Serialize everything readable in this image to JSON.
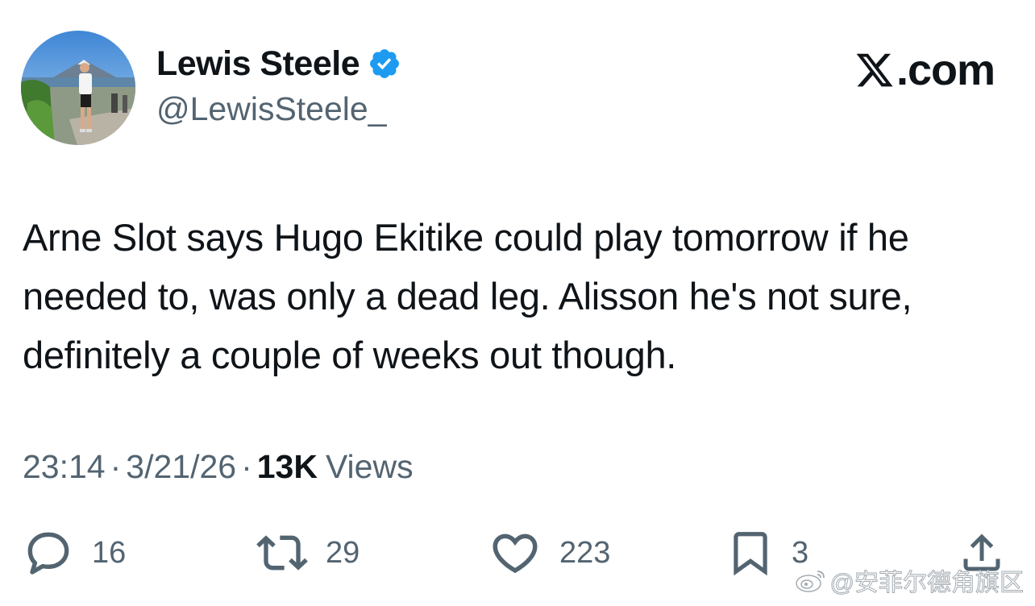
{
  "author": {
    "display_name": "Lewis Steele",
    "handle": "@LewisSteele_",
    "verified": true,
    "verified_color": "#1d9bf0"
  },
  "brand": {
    "suffix": ".com"
  },
  "tweet": {
    "text": "Arne Slot says Hugo Ekitike could play tomorrow if he needed to, was only a dead leg. Alisson he's not sure, definitely a couple of weeks out though."
  },
  "meta": {
    "time": "23:14",
    "date": "3/21/26",
    "separator": "·",
    "views_count": "13K",
    "views_label": "Views"
  },
  "actions": {
    "replies": {
      "icon": "reply-icon",
      "count": "16"
    },
    "reposts": {
      "icon": "repost-icon",
      "count": "29"
    },
    "likes": {
      "icon": "heart-icon",
      "count": "223"
    },
    "bookmarks": {
      "icon": "bookmark-icon",
      "count": "3"
    },
    "share": {
      "icon": "share-icon"
    }
  },
  "watermark": {
    "text": "@安菲尔德角旗区"
  },
  "colors": {
    "text_primary": "#0f1419",
    "text_secondary": "#536471",
    "accent": "#1d9bf0",
    "background": "#ffffff"
  }
}
